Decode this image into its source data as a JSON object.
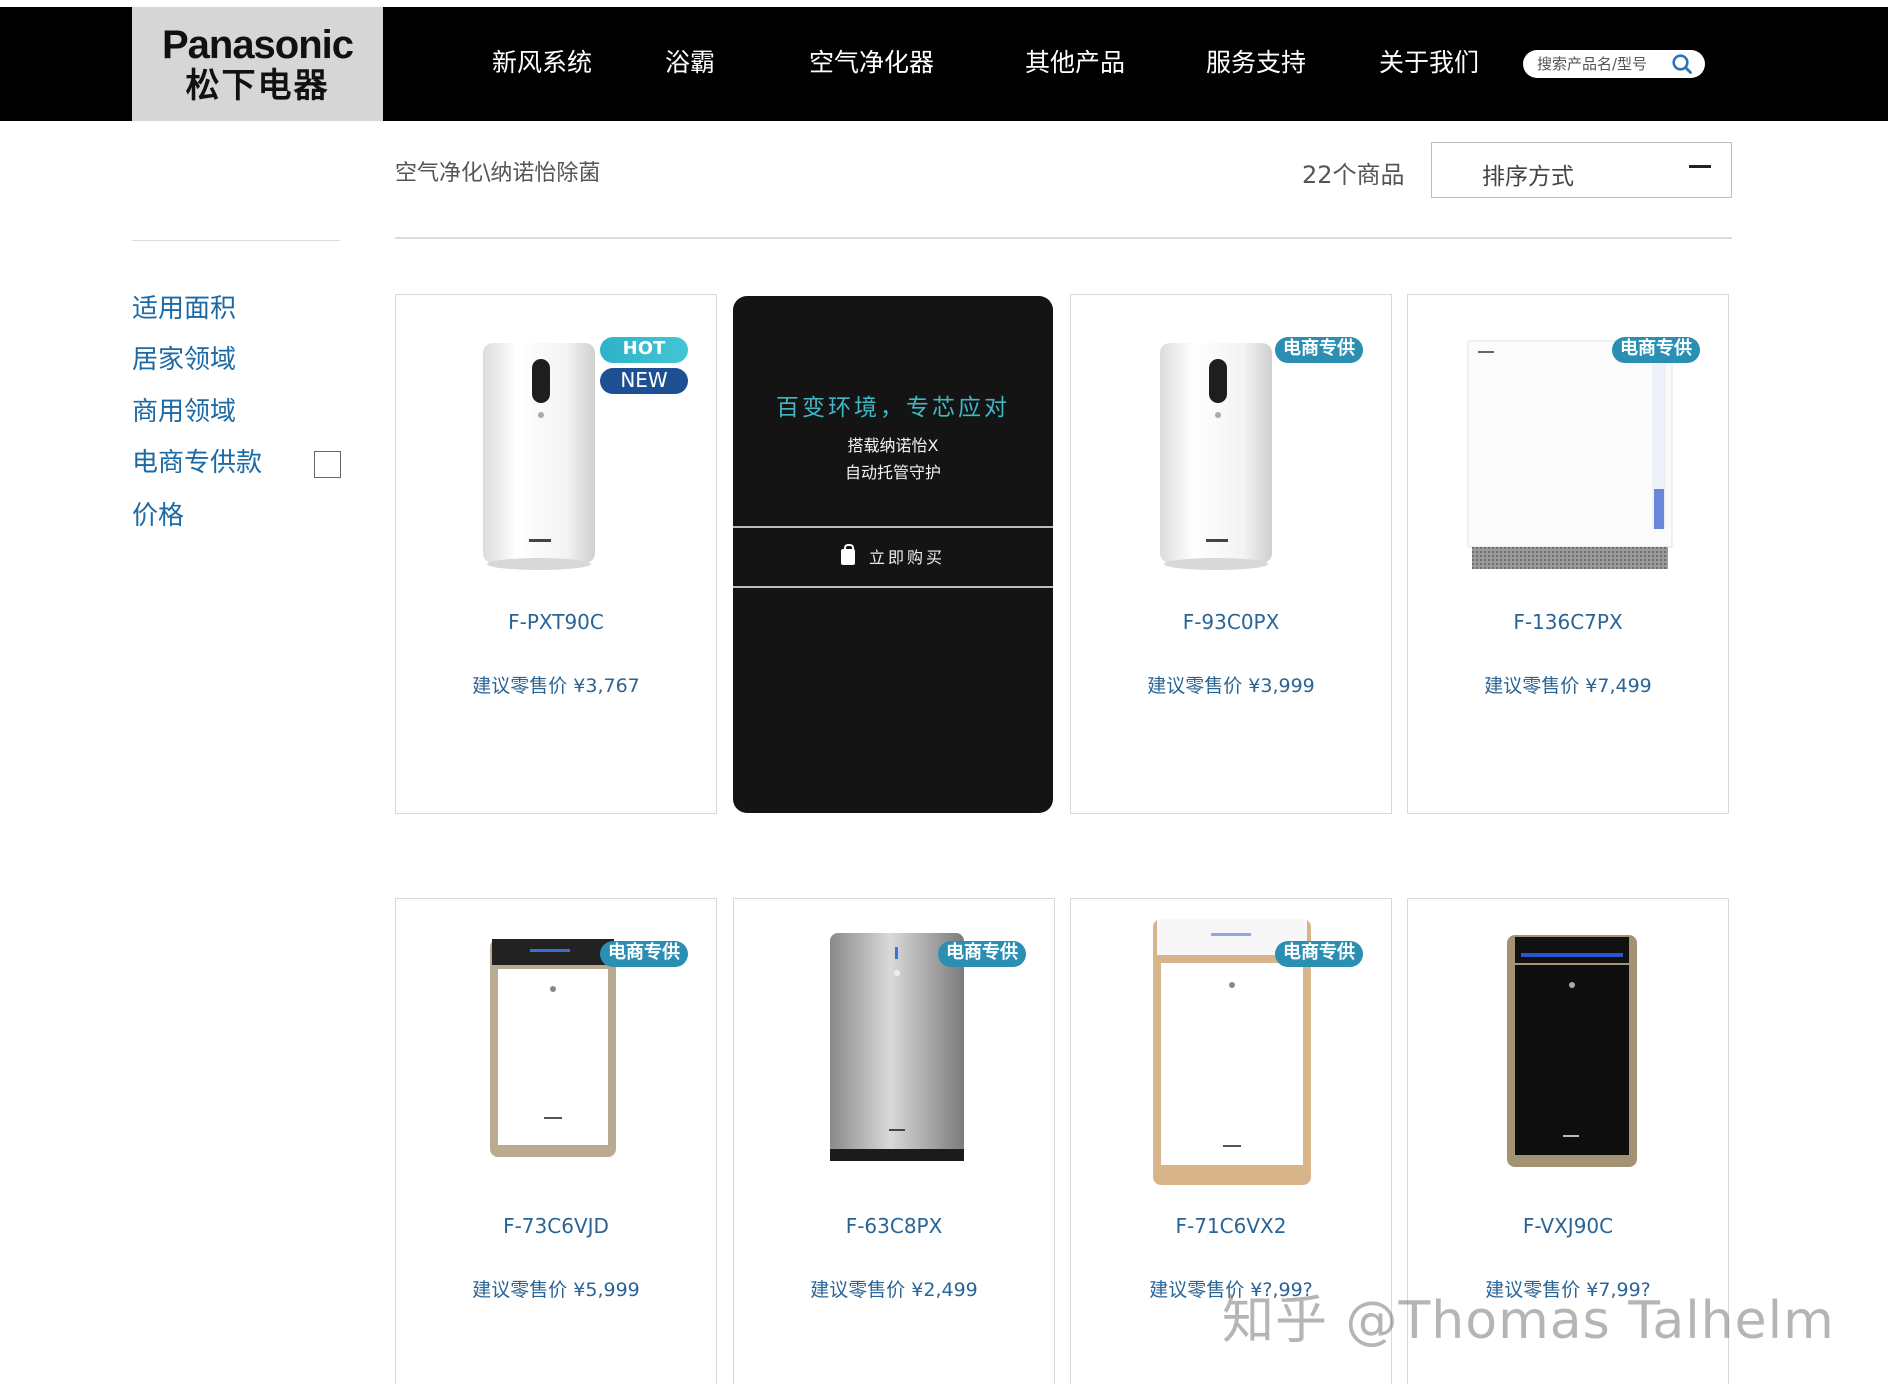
{
  "header": {
    "logo_brand": "Panasonic",
    "logo_cn": "松下电器",
    "nav": [
      {
        "label": "新风系统"
      },
      {
        "label": "浴霸"
      },
      {
        "label": "空气净化器"
      },
      {
        "label": "其他产品"
      },
      {
        "label": "服务支持"
      },
      {
        "label": "关于我们"
      }
    ],
    "search_placeholder": "搜索产品名/型号",
    "search_icon": "search-icon"
  },
  "toolbar": {
    "breadcrumb": "空气净化\\纳诺怡除菌",
    "count": "22个商品",
    "sort_label": "排序方式"
  },
  "sidebar": {
    "filters": [
      {
        "label": "适用面积"
      },
      {
        "label": "居家领域"
      },
      {
        "label": "商用领域"
      },
      {
        "label": "电商专供款"
      },
      {
        "label": "价格"
      }
    ]
  },
  "promo": {
    "headline": "百变环境，专芯应对",
    "line1": "搭载纳诺怡X",
    "line2": "自动托管守护",
    "buy_label": "立即购买"
  },
  "products": [
    {
      "model": "F-PXT90C",
      "price": "建议零售价 ¥3,767",
      "tags": [
        "HOT",
        "NEW"
      ]
    },
    {
      "model": "F-93C0PX",
      "price": "建议零售价 ¥3,999",
      "tags": [
        "电商专供"
      ]
    },
    {
      "model": "F-136C7PX",
      "price": "建议零售价 ¥7,499",
      "tags": [
        "电商专供"
      ]
    },
    {
      "model": "F-73C6VJD",
      "price": "建议零售价 ¥5,999",
      "tags": [
        "电商专供"
      ]
    },
    {
      "model": "F-63C8PX",
      "price": "建议零售价 ¥2,499",
      "tags": [
        "电商专供"
      ]
    },
    {
      "model": "F-71C6VX2",
      "price": "建议零售价 ¥?,99?",
      "tags": [
        "电商专供"
      ]
    },
    {
      "model": "F-VXJ90C",
      "price": "建议零售价 ¥7,99?",
      "tags": []
    }
  ],
  "watermark": "知乎 @Thomas Talhelm",
  "colors": {
    "header_bg": "#000000",
    "logo_bg": "#d6d6d6",
    "link_blue": "#1b6aa6",
    "tag_teal": "#2a8fb3",
    "tag_navy": "#1d4f93",
    "promo_bg": "#141414",
    "promo_accent": "#3fb8c4"
  }
}
